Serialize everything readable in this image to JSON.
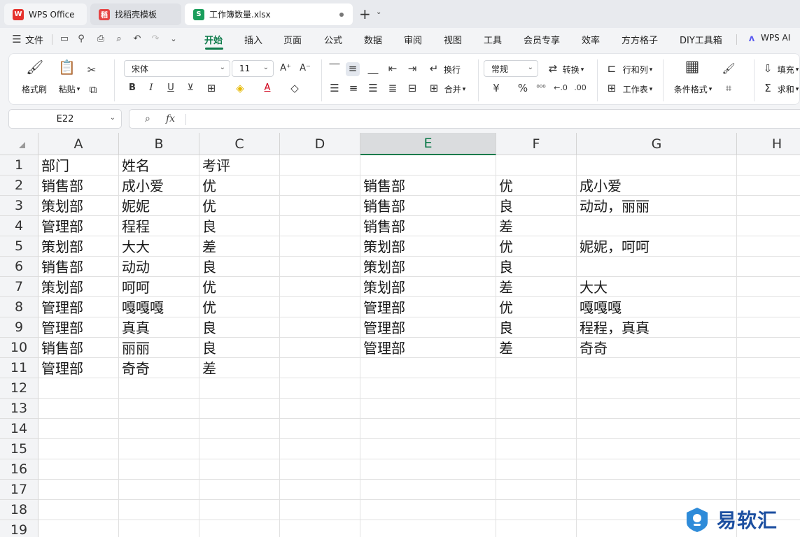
{
  "tabs": [
    {
      "label": "WPS Office",
      "icon": "wps-logo-icon"
    },
    {
      "label": "找稻壳模板",
      "icon": "docer-icon"
    },
    {
      "label": "工作簿数量.xlsx",
      "icon": "spreadsheet-icon"
    }
  ],
  "menu": {
    "file_label": "文件",
    "items": [
      "开始",
      "插入",
      "页面",
      "公式",
      "数据",
      "审阅",
      "视图",
      "工具",
      "会员专享",
      "效率",
      "方方格子",
      "DIY工具箱"
    ],
    "ai_label": "WPS AI",
    "active": "开始"
  },
  "ribbon": {
    "format_painter": "格式刷",
    "paste": "粘贴",
    "font_name": "宋体",
    "font_size": "11",
    "wrap": "换行",
    "merge": "合并",
    "number_format": "常规",
    "convert": "转换",
    "row_col": "行和列",
    "worksheet": "工作表",
    "cond_format": "条件格式",
    "fill": "填充",
    "sum": "求和",
    "bold": "B",
    "italic": "I",
    "underline": "U",
    "strike": "ꓘ",
    "currency": "¥",
    "percent": "%"
  },
  "formula_bar": {
    "name_box": "E22",
    "fx": "fx",
    "value": ""
  },
  "columns": [
    "A",
    "B",
    "C",
    "D",
    "E",
    "F",
    "G",
    "H"
  ],
  "selected_column": "E",
  "rows": [
    "1",
    "2",
    "3",
    "4",
    "5",
    "6",
    "7",
    "8",
    "9",
    "10",
    "11",
    "12",
    "13",
    "14",
    "15",
    "16",
    "17",
    "18",
    "19"
  ],
  "sheet": {
    "A": [
      "部门",
      "销售部",
      "策划部",
      "管理部",
      "策划部",
      "销售部",
      "策划部",
      "管理部",
      "管理部",
      "销售部",
      "管理部"
    ],
    "B": [
      "姓名",
      "成小爱",
      "妮妮",
      "程程",
      "大大",
      "动动",
      "呵呵",
      "嘎嘎嘎",
      "真真",
      "丽丽",
      "奇奇"
    ],
    "C": [
      "考评",
      "优",
      "优",
      "良",
      "差",
      "良",
      "优",
      "优",
      "良",
      "良",
      "差"
    ],
    "E": [
      "",
      "销售部",
      "销售部",
      "销售部",
      "策划部",
      "策划部",
      "策划部",
      "管理部",
      "管理部",
      "管理部"
    ],
    "F": [
      "",
      "优",
      "良",
      "差",
      "优",
      "良",
      "差",
      "优",
      "良",
      "差"
    ],
    "G": [
      "",
      "成小爱",
      "动动，丽丽",
      "",
      "妮妮，呵呵",
      "",
      "大大",
      "嘎嘎嘎",
      "程程，真真",
      "奇奇"
    ]
  },
  "watermark": "易软汇",
  "colors": {
    "accent": "#0d7a4a",
    "watermark": "#1c4fa0"
  }
}
